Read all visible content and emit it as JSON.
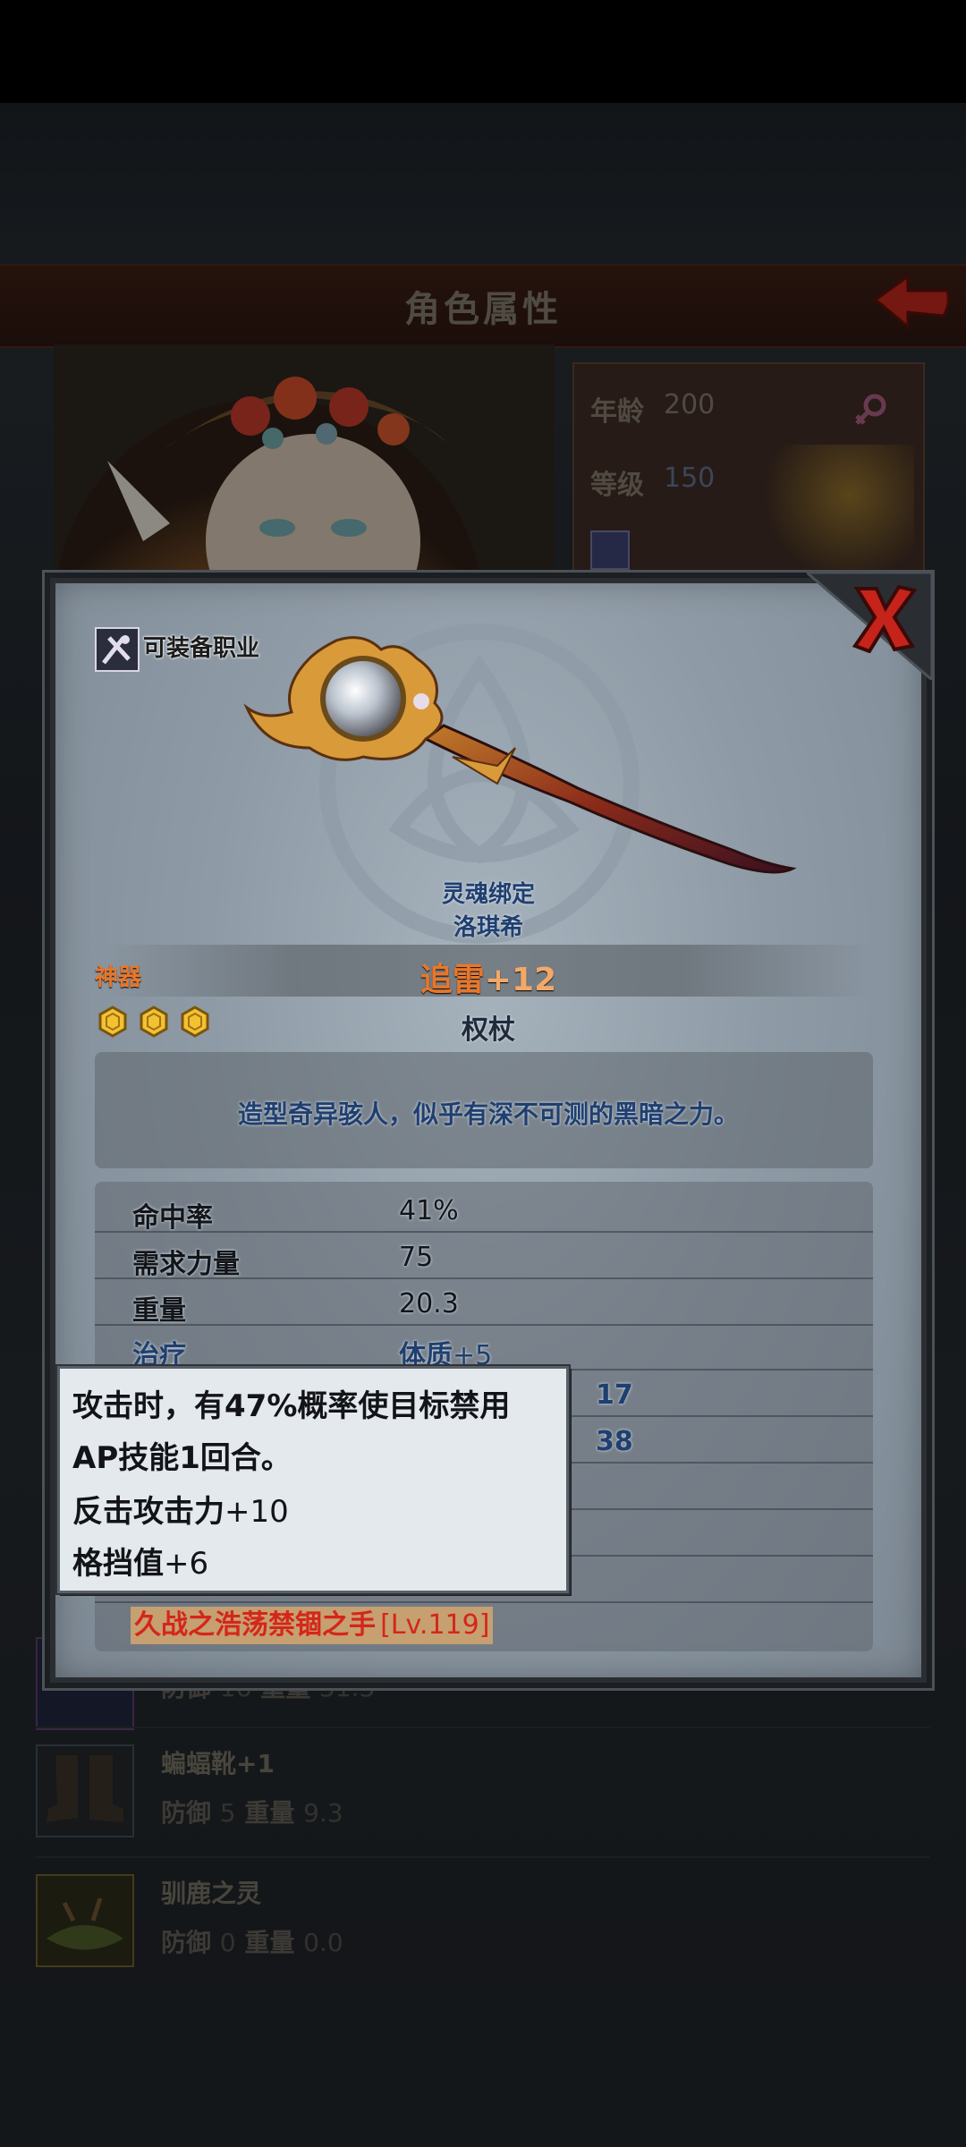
{
  "background_screen": {
    "title": "角色属性",
    "stats": {
      "age_label": "年龄",
      "age_value": "200",
      "level_label": "等级",
      "level_value": "150"
    },
    "equipment_list": [
      {
        "name": "",
        "defense_label": "防御",
        "defense_value": "16",
        "weight_label": "重量",
        "weight_value": "31.3"
      },
      {
        "name": "蝙蝠靴+1",
        "defense_label": "防御",
        "defense_value": "5",
        "weight_label": "重量",
        "weight_value": "9.3"
      },
      {
        "name": "驯鹿之灵",
        "defense_label": "防御",
        "defense_value": "0",
        "weight_label": "重量",
        "weight_value": "0.0"
      }
    ]
  },
  "item_popup": {
    "class_label": "可装备职业",
    "soulbound_line1": "灵魂绑定",
    "soulbound_line2": "洛琪希",
    "rarity": "神器",
    "item_name": "追雷",
    "enhance": "+12",
    "star_count": 3,
    "item_type": "权杖",
    "description": "造型奇异骇人，似乎有深不可测的黑暗之力。",
    "attributes": [
      {
        "label": "命中率",
        "value": "41%"
      },
      {
        "label": "需求力量",
        "value": "75"
      },
      {
        "label": "重量",
        "value": "20.3"
      },
      {
        "label": "治疗",
        "value_main": "体质",
        "value_plus": "+5"
      }
    ],
    "partial_values": [
      "17",
      "38"
    ],
    "set_name": "久战之浩荡禁锢之手",
    "set_level": "[Lv.119]"
  },
  "tooltip": {
    "line1": "攻击时，有47%概率使目标禁用",
    "line2": "AP技能1回合。",
    "line3_main": "反击攻击力",
    "line3_num": "+10",
    "line4_main": "格挡值",
    "line4_num": "+6"
  },
  "colors": {
    "rarity_orange": "#e8772b",
    "set_red": "#d5261b",
    "blue_text": "#1f3f70"
  },
  "icons": [
    "back-arrow-icon",
    "close-x-icon",
    "class-icon",
    "star-hexagon-icon",
    "staff-weapon-image"
  ]
}
